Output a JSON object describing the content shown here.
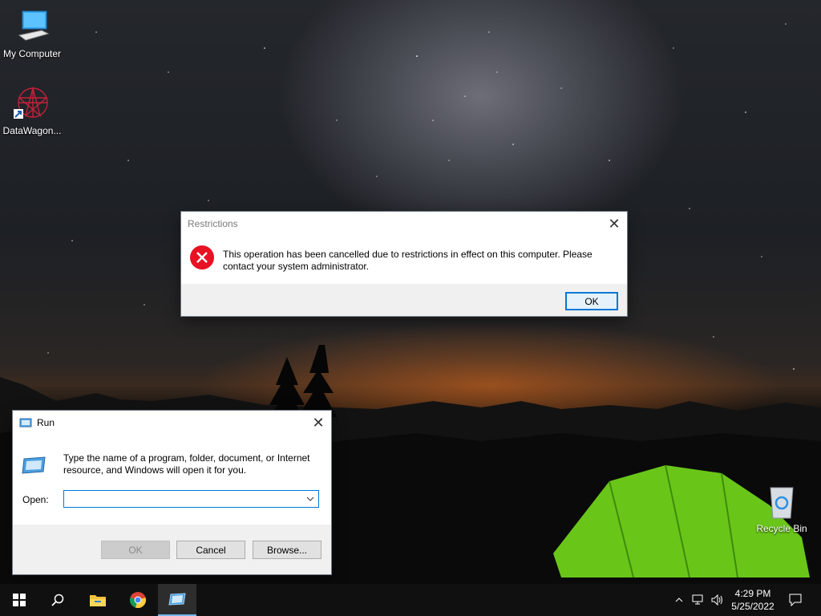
{
  "desktop": {
    "icons": [
      {
        "label": "My Computer",
        "icon": "computer-icon"
      },
      {
        "label": "DataWagon...",
        "icon": "datawagon-shortcut-icon"
      },
      {
        "label": "Recycle Bin",
        "icon": "recycle-bin-icon"
      }
    ]
  },
  "restrictions_dialog": {
    "title": "Restrictions",
    "message_line1": "This operation has been cancelled due to restrictions in effect on this computer. Please",
    "message_line2": "contact your system administrator.",
    "ok_label": "OK",
    "icon": "error-icon"
  },
  "run_dialog": {
    "title": "Run",
    "description_line1": "Type the name of a program, folder, document, or Internet",
    "description_line2": "resource, and Windows will open it for you.",
    "open_label": "Open:",
    "open_value": "",
    "ok_label": "OK",
    "cancel_label": "Cancel",
    "browse_label": "Browse..."
  },
  "taskbar": {
    "items": [
      "start-icon",
      "search-icon",
      "file-explorer-icon",
      "chrome-icon",
      "run-app-icon"
    ],
    "clock_time": "4:29 PM",
    "clock_date": "5/25/2022"
  },
  "colors": {
    "accent": "#0078d7",
    "error_red": "#e81123",
    "tent_green": "#7ddc1f",
    "taskbar": "#101010"
  }
}
